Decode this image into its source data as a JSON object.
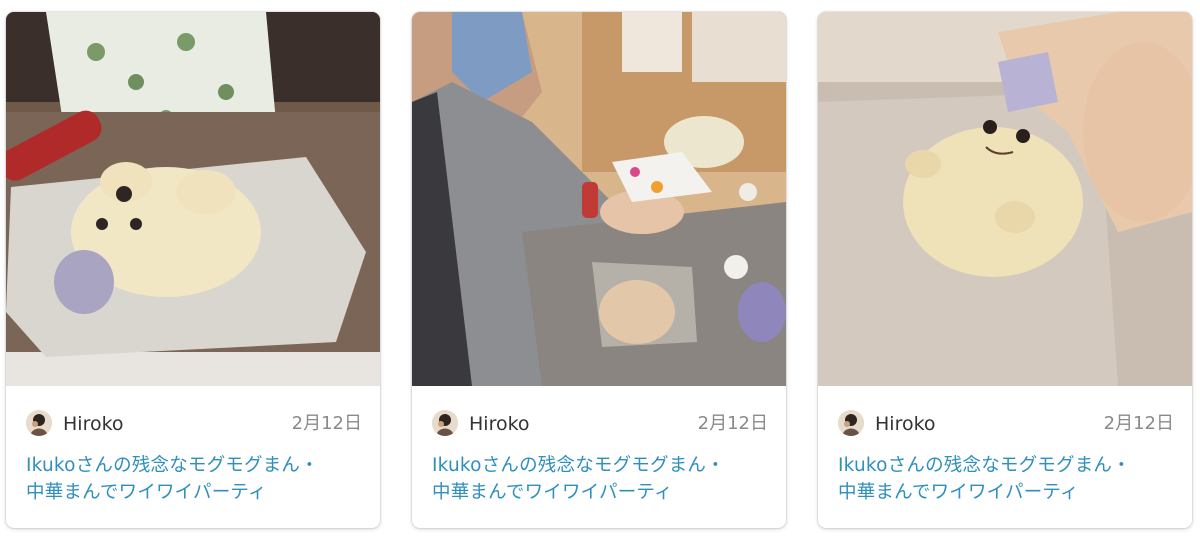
{
  "colors": {
    "title_link": "#2f8fbf",
    "author_text": "#333333",
    "date_text": "#8a8a8a",
    "card_bg": "#ffffff"
  },
  "cards": [
    {
      "photo_icon": "dough-bun-photo",
      "author": "Hiroko",
      "date": "2月12日",
      "title_line1": "Ikukoさんの残念なモグモグまん・",
      "title_line2": "中華まんでワイワイパーティ"
    },
    {
      "photo_icon": "person-shaping-dough-photo",
      "author": "Hiroko",
      "date": "2月12日",
      "title_line1": "Ikukoさんの残念なモグモグまん・",
      "title_line2": "中華まんでワイワイパーティ"
    },
    {
      "photo_icon": "seal-shaped-bun-photo",
      "author": "Hiroko",
      "date": "2月12日",
      "title_line1": "Ikukoさんの残念なモグモグまん・",
      "title_line2": "中華まんでワイワイパーティ"
    }
  ]
}
